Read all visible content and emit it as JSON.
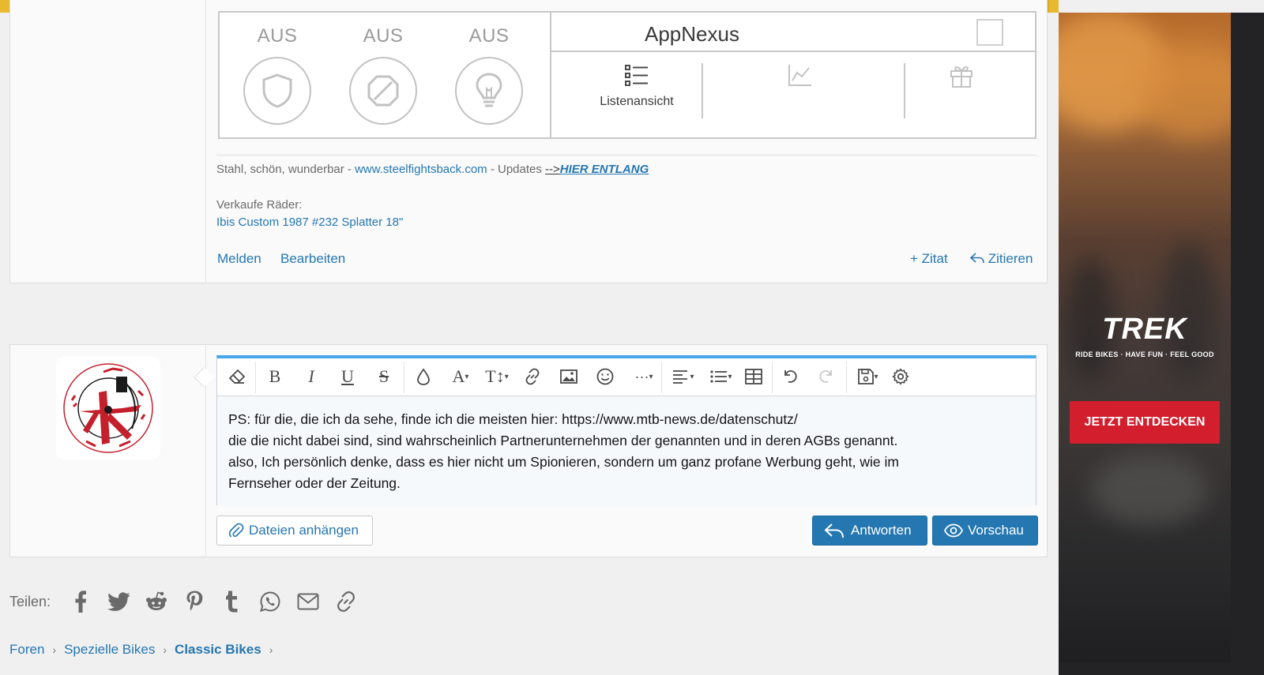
{
  "ad": {
    "status_labels": [
      "AUS",
      "AUS",
      "AUS"
    ],
    "brand": "AppNexus",
    "tab_list_label": "Listenansicht"
  },
  "post": {
    "signature": {
      "prefix": "Stahl, schön, wunderbar - ",
      "site": "www.steelfightsback.com",
      "middle": " - Updates ",
      "arrow": "-->",
      "hier": "HIER ENTLANG",
      "sell_label": "Verkaufe Räder:",
      "sell_item": "Ibis Custom 1987 #232 Splatter 18\""
    },
    "actions": {
      "report": "Melden",
      "edit": "Bearbeiten",
      "multiquote": "+ Zitat",
      "quote": "Zitieren"
    }
  },
  "reply": {
    "lines": [
      "PS: für die, die ich da sehe, finde ich die meisten hier: https://www.mtb-news.de/datenschutz/",
      "die die nicht dabei sind, sind wahrscheinlich Partnerunternehmen der genannten und in deren AGBs genannt.",
      "also, Ich persönlich denke, dass es hier nicht um Spionieren, sondern um ganz profane Werbung geht, wie im",
      "Fernseher oder der Zeitung."
    ],
    "attach_label": "Dateien anhängen",
    "reply_label": "Antworten",
    "preview_label": "Vorschau"
  },
  "share": {
    "label": "Teilen:"
  },
  "breadcrumb": [
    "Foren",
    "Spezielle Bikes",
    "Classic Bikes"
  ],
  "side_ad": {
    "brand": "TREK",
    "tagline": "RIDE BIKES · HAVE FUN · FEEL GOOD",
    "cta": "JETZT ENTDECKEN"
  },
  "colors": {
    "link": "#2577b1",
    "accent_bar": "#e8b92f",
    "editor_focus": "#47a7eb",
    "ad_cta": "#d21e2d"
  },
  "icons": {
    "toolbar": [
      "eraser-icon",
      "bold-icon",
      "italic-icon",
      "underline-icon",
      "strikethrough-icon",
      "color-drop-icon",
      "font-family-icon",
      "font-size-icon",
      "link-icon",
      "image-icon",
      "emoji-icon",
      "more-icon",
      "align-icon",
      "list-icon",
      "table-icon",
      "undo-icon",
      "redo-icon",
      "drafts-icon",
      "settings-icon"
    ],
    "share": [
      "facebook-icon",
      "twitter-icon",
      "reddit-icon",
      "pinterest-icon",
      "tumblr-icon",
      "whatsapp-icon",
      "email-icon",
      "link-icon"
    ]
  }
}
